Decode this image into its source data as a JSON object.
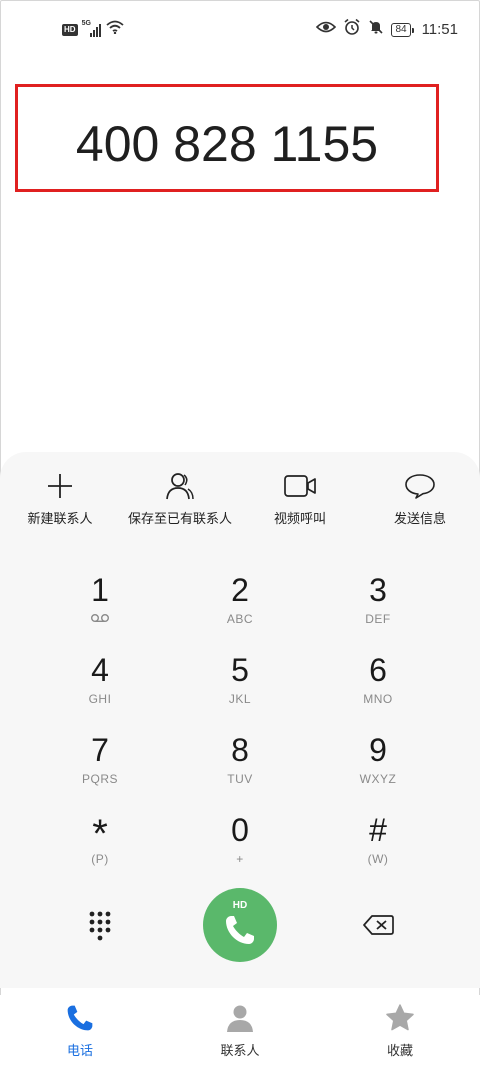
{
  "status_bar": {
    "hd": "HD",
    "network": "5G",
    "battery": "84",
    "time": "11:51"
  },
  "dialer": {
    "number": "400 828 1155"
  },
  "actions": [
    {
      "label": "新建联系人",
      "icon": "plus-icon"
    },
    {
      "label": "保存至已有联系人",
      "icon": "person-icon"
    },
    {
      "label": "视频呼叫",
      "icon": "video-camera-icon"
    },
    {
      "label": "发送信息",
      "icon": "message-bubble-icon"
    }
  ],
  "keys": [
    {
      "digit": "1",
      "sub": ""
    },
    {
      "digit": "2",
      "sub": "ABC"
    },
    {
      "digit": "3",
      "sub": "DEF"
    },
    {
      "digit": "4",
      "sub": "GHI"
    },
    {
      "digit": "5",
      "sub": "JKL"
    },
    {
      "digit": "6",
      "sub": "MNO"
    },
    {
      "digit": "7",
      "sub": "PQRS"
    },
    {
      "digit": "8",
      "sub": "TUV"
    },
    {
      "digit": "9",
      "sub": "WXYZ"
    },
    {
      "digit": "*",
      "sub": "(P)"
    },
    {
      "digit": "0",
      "sub": "+"
    },
    {
      "digit": "#",
      "sub": "(W)"
    }
  ],
  "call_button": {
    "badge": "HD"
  },
  "tabs": [
    {
      "label": "电话",
      "active": true
    },
    {
      "label": "联系人",
      "active": false
    },
    {
      "label": "收藏",
      "active": false
    }
  ],
  "colors": {
    "accent": "#1a6fe0",
    "call_green": "#5ab86b",
    "highlight_border": "#e02020"
  }
}
